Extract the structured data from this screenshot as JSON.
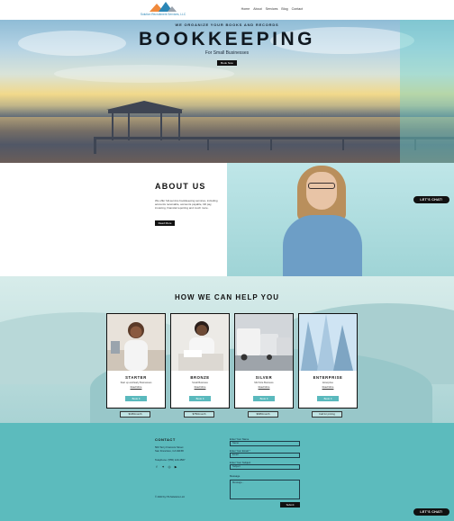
{
  "header": {
    "logo_text": "Solution Recruitment Services, LLC",
    "nav": [
      "Home",
      "About",
      "Services",
      "Blog",
      "Contact"
    ]
  },
  "hero": {
    "kicker": "WE ORGANIZE YOUR BOOKS AND RECORDS",
    "title": "BOOKKEEPING",
    "subtitle": "For Small Businesses",
    "button": "Book Now"
  },
  "about": {
    "title": "ABOUT US",
    "text": "We offer full-service bookkeeping services, including accounts receivable, accounts payable, bill pay, invoicing, financial reporting and much more.",
    "button": "Read More"
  },
  "chat": {
    "label": "LET'S CHAT!"
  },
  "services": {
    "title": "HOW WE CAN HELP YOU",
    "cards": [
      {
        "name": "STARTER",
        "desc": "Start up and Early Businesses",
        "more": "Read More",
        "button": "Book It"
      },
      {
        "name": "BRONZE",
        "desc": "Small Business",
        "more": "Read More",
        "button": "Book It"
      },
      {
        "name": "SILVER",
        "desc": "Mid Size Business",
        "more": "Read More",
        "button": "Book It"
      },
      {
        "name": "ENTERPRISE",
        "desc": "Enterprise",
        "more": "Read More",
        "button": "Book It"
      }
    ],
    "prices": [
      "$195/month",
      "$750/month",
      "$995/month",
      "Call for pricing"
    ]
  },
  "footer": {
    "contact_heading": "CONTACT",
    "address_line1": "500 Terry Francois Street",
    "address_line2": "San Francisco, CA 94158",
    "phone": "Telephone: (555) 123-4567",
    "social_icons": [
      "facebook-icon",
      "twitter-icon",
      "instagram-icon",
      "youtube-icon"
    ],
    "copyright": "© 2023 by ITA Solutions LLC",
    "form": {
      "name_label": "Enter Your Name",
      "name_placeholder": "Name",
      "email_label": "Enter Your Email *",
      "email_placeholder": "Email",
      "subject_label": "Enter Your Subject",
      "subject_placeholder": "Subject",
      "message_label": "Message",
      "message_placeholder": "Message...",
      "submit": "Submit"
    }
  },
  "colors": {
    "teal": "#5cbbbd",
    "dark": "#111111",
    "logo_blue": "#2a86b6"
  }
}
